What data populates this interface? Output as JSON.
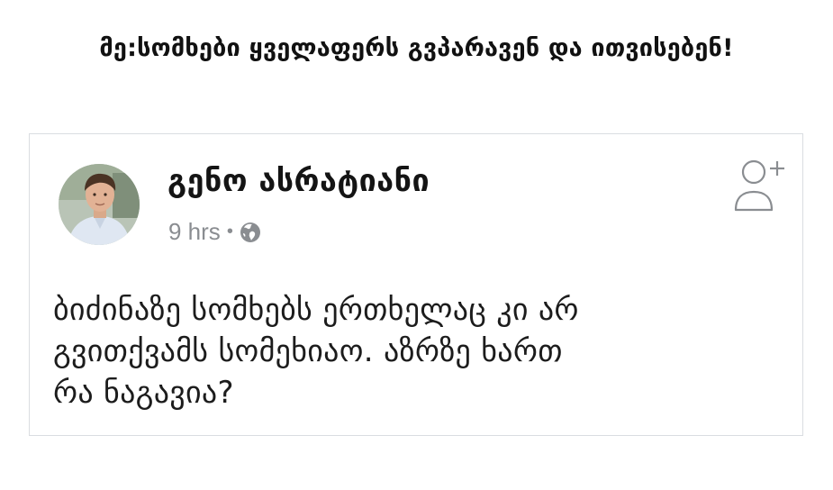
{
  "headline": "მე:სომხები ყველაფერს გვპარავენ და ითვისებენ!",
  "post": {
    "author_name": "გენო ასრატიანი",
    "time": "9 hrs",
    "separator": "•",
    "privacy_icon": "globe-icon",
    "add_friend_icon": "add-friend-icon",
    "text_lines": [
      "ბიძინაზე  სომხებს ერთხელაც კი  არ",
      "გვითქვამს  სომეხიაო. აზრზე ხართ",
      "რა ნაგავია?"
    ]
  },
  "colors": {
    "text": "#1c1c1c",
    "meta": "#8a8d91",
    "border": "#dadde1",
    "icon": "#8a8d91"
  }
}
